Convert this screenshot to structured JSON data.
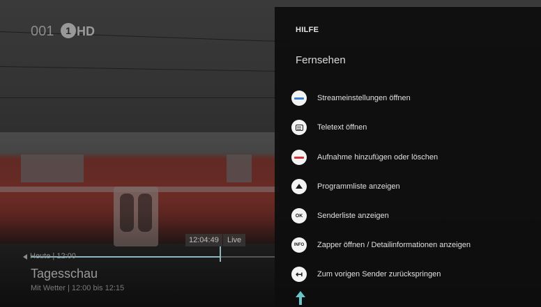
{
  "channel": {
    "number": "001",
    "logo_text": "1",
    "hd_label": "HD"
  },
  "osd": {
    "time": "12:04:49",
    "live_label": "Live",
    "day_label": "Heute  |  12:00",
    "progress": 0.78
  },
  "program": {
    "title": "Tagesschau",
    "subtitle": "Mit Wetter  |  12:00 bis 12:15"
  },
  "help": {
    "title": "HILFE",
    "section": "Fernsehen",
    "items": [
      {
        "icon": "blue-key-icon",
        "color": "#3a7fd9",
        "label": "Streameinstellungen öffnen"
      },
      {
        "icon": "teletext-icon",
        "label": "Teletext öffnen"
      },
      {
        "icon": "red-key-icon",
        "color": "#d9313a",
        "label": "Aufnahme hinzufügen oder löschen"
      },
      {
        "icon": "up-arrow-icon",
        "label": "Programmliste anzeigen"
      },
      {
        "icon": "ok-key-icon",
        "key_text": "OK",
        "label": "Senderliste anzeigen"
      },
      {
        "icon": "info-key-icon",
        "key_text": "INFO",
        "label": "Zapper öffnen / Detailinformationen anzeigen"
      },
      {
        "icon": "back-key-icon",
        "key_text": "↤",
        "label": "Zum vorigen Sender zurückspringen"
      }
    ]
  },
  "colors": {
    "accent": "#68c5c8",
    "panel": "#0e0e0e"
  }
}
